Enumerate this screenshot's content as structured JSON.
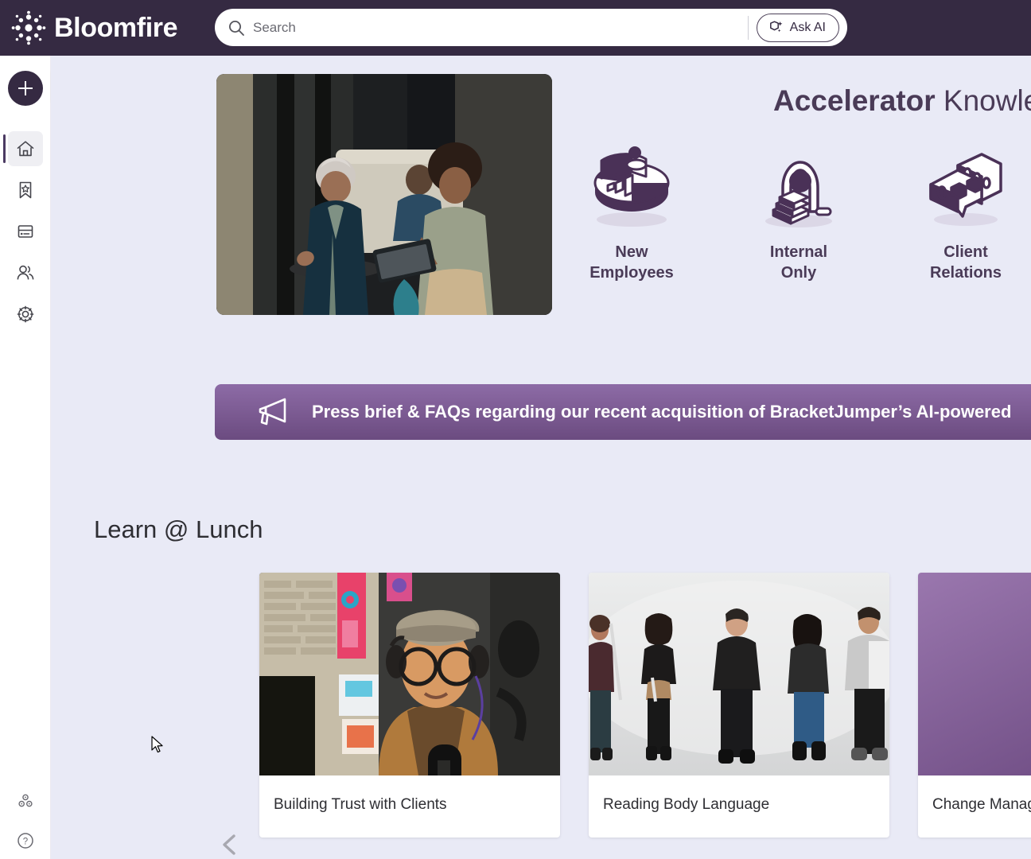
{
  "brand": {
    "name": "Bloomfire",
    "logo_icon": "bloomfire-burst-logo"
  },
  "search": {
    "placeholder": "Search",
    "value": "",
    "icon": "search-icon"
  },
  "ask_ai": {
    "label": "Ask AI",
    "icon": "sparkle-ai-icon"
  },
  "sidebar": {
    "add_button": {
      "label": "+",
      "icon": "plus-icon"
    },
    "expand": {
      "icon": "chevron-right-icon"
    },
    "items": [
      {
        "name": "home",
        "icon": "home-icon",
        "active": true
      },
      {
        "name": "bookmarks",
        "icon": "bookmark-star-icon",
        "active": false
      },
      {
        "name": "series",
        "icon": "card-list-icon",
        "active": false
      },
      {
        "name": "people",
        "icon": "people-icon",
        "active": false
      },
      {
        "name": "settings",
        "icon": "gear-icon",
        "active": false
      }
    ],
    "bottom_items": [
      {
        "name": "communities",
        "icon": "cluster-icon"
      },
      {
        "name": "help",
        "icon": "question-circle-icon"
      }
    ]
  },
  "hero": {
    "image_alt": "two-women-talking-with-tablet",
    "title_bold": "Accelerator",
    "title_rest": " Knowle",
    "categories": [
      {
        "label_line1": "New",
        "label_line2": "Employees",
        "icon": "pie-chart-3d-icon"
      },
      {
        "label_line1": "Internal",
        "label_line2": "Only",
        "icon": "podium-3d-icon"
      },
      {
        "label_line1": "Client",
        "label_line2": "Relations",
        "icon": "chat-bubbles-3d-icon"
      }
    ]
  },
  "banner": {
    "icon": "megaphone-icon",
    "text": "Press brief & FAQs regarding our recent acquisition of BracketJumper’s AI-powered",
    "bg_start": "#8d6ba6",
    "bg_end": "#6b4b80"
  },
  "section": {
    "title": "Learn @ Lunch",
    "prev_icon": "chevron-left-icon",
    "cards": [
      {
        "title": "Building Trust with Clients",
        "image_alt": "man-with-flat-cap-headphones-podcast-microphone"
      },
      {
        "title": "Reading Body Language",
        "image_alt": "five-people-standing-in-a-row-gray-backdrop"
      },
      {
        "title": "Change Managemen",
        "image_alt": "purple-isometric-pyramid-arrow-graphic"
      }
    ]
  },
  "colors": {
    "header_bg": "#352a42",
    "page_bg": "#e9eaf6",
    "accent_purple": "#4a3b57",
    "banner_purple": "#7e5d95"
  }
}
